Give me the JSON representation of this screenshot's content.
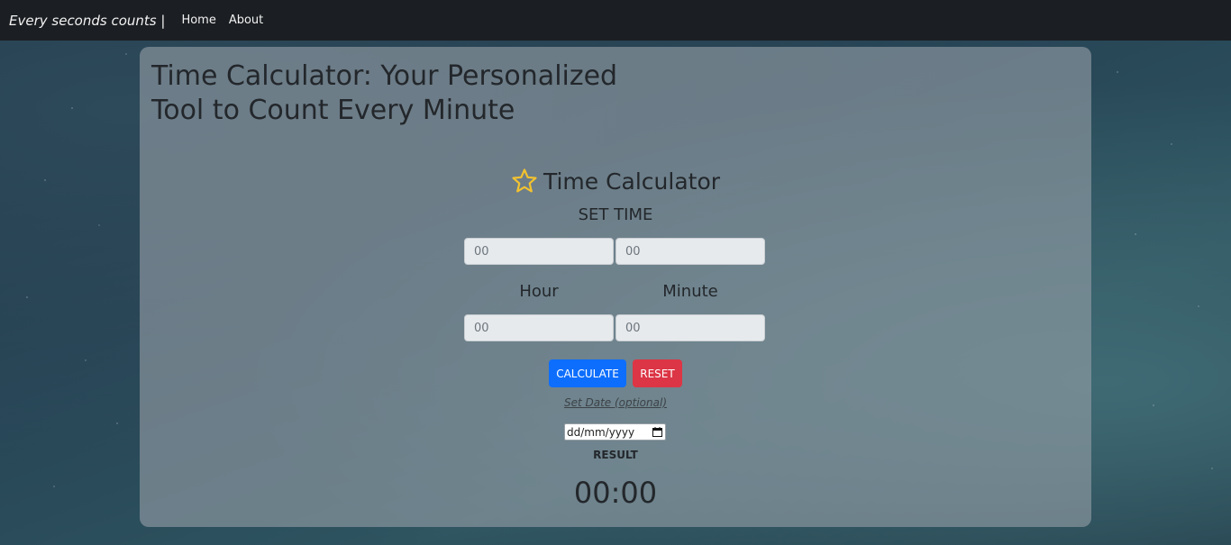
{
  "navbar": {
    "brand": "Every seconds counts |",
    "links": [
      "Home",
      "About"
    ]
  },
  "page": {
    "title": "Time Calculator: Your Personalized Tool to Count Every Minute"
  },
  "calculator": {
    "icon": "star-icon",
    "title": "Time Calculator",
    "set_time_label": "SET TIME",
    "time_inputs": [
      {
        "placeholder": "00",
        "value": ""
      },
      {
        "placeholder": "00",
        "value": ""
      }
    ],
    "hour_label": "Hour",
    "minute_label": "Minute",
    "duration_inputs": [
      {
        "placeholder": "00",
        "value": ""
      },
      {
        "placeholder": "00",
        "value": ""
      }
    ],
    "calculate_label": "CALCULATE",
    "reset_label": "RESET",
    "set_date_label": "Set Date (optional)",
    "date_placeholder": "dd/mm/yyyy",
    "result_label": "RESULT",
    "result_value": "00:00"
  },
  "colors": {
    "navbar_bg": "#1b1e22",
    "primary": "#0d6efd",
    "danger": "#dc3545",
    "star": "#f2c230"
  }
}
